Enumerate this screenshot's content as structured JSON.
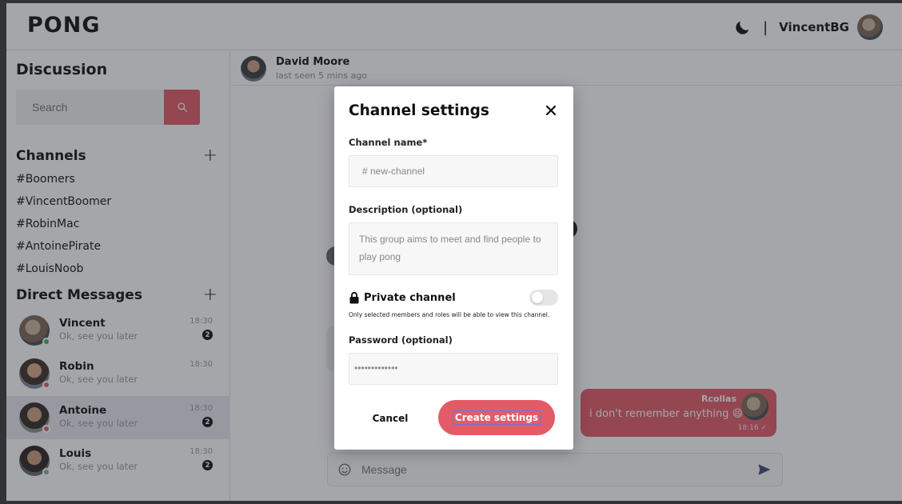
{
  "app": {
    "title": "PONG"
  },
  "header": {
    "separator": "|",
    "username": "VincentBG"
  },
  "sidebar": {
    "title": "Discussion",
    "search_placeholder": "Search",
    "channels_title": "Channels",
    "channels": [
      "#Boomers",
      "#VincentBoomer",
      "#RobinMac",
      "#AntoinePirate",
      "#LouisNoob"
    ],
    "dm_title": "Direct Messages",
    "dms": [
      {
        "name": "Vincent",
        "message": "Ok, see you later",
        "time": "18:30",
        "unread": "2",
        "status_color": "#3bb54a"
      },
      {
        "name": "Robin",
        "message": "Ok, see you later",
        "time": "18:30",
        "unread": "",
        "status_color": "#e25b67"
      },
      {
        "name": "Antoine",
        "message": "Ok, see you later",
        "time": "18:30",
        "unread": "2",
        "status_color": "#e25b67"
      },
      {
        "name": "Louis",
        "message": "Ok, see you later",
        "time": "18:30",
        "unread": "2",
        "status_color": "#9aa0a6"
      }
    ]
  },
  "chat": {
    "contact_name": "David Moore",
    "contact_status": "last seen 5 mins ago",
    "message": {
      "author": "Rcollas",
      "text": "i don't remember anything 😄",
      "time": "18:16 ✓"
    },
    "input_placeholder": "Message"
  },
  "modal": {
    "title": "Channel settings",
    "name_label": "Channel name*",
    "name_placeholder": "# new-channel",
    "description_label": "Description (optional)",
    "description_placeholder": "This group aims to meet and find people to play pong",
    "private_label": "Private channel",
    "private_help": "Only selected members and roles will be able to view this channel.",
    "private_enabled": false,
    "password_label": "Password (optional)",
    "password_value": "•••••••••••••",
    "cancel_label": "Cancel",
    "create_label": "Create settings"
  },
  "colors": {
    "accent": "#e25b67",
    "overlay": "rgba(40,42,52,0.42)"
  }
}
